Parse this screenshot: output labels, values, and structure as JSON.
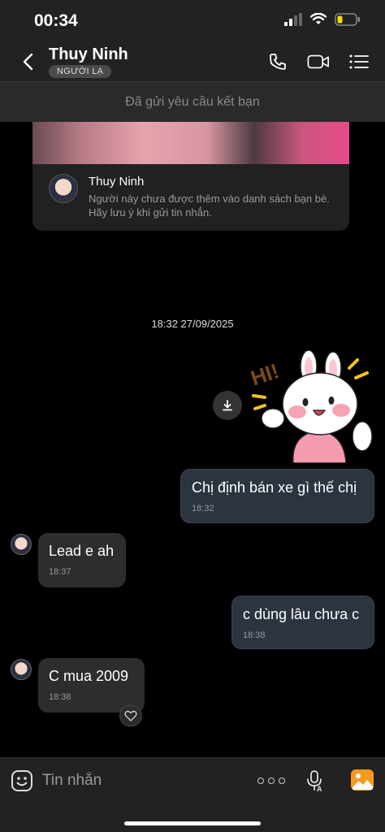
{
  "status_bar": {
    "time": "00:34"
  },
  "header": {
    "contact_name": "Thuy Ninh",
    "badge": "NGƯỜI LẠ"
  },
  "banner": {
    "text": "Đã gửi yêu cầu kết bạn"
  },
  "profile_card": {
    "name": "Thuy Ninh",
    "note": "Người này chưa được thêm vào danh sách bạn bè. Hãy lưu ý khi gửi tin nhắn."
  },
  "timestamp": "18:32 27/09/2025",
  "sticker": {
    "text": "HI!"
  },
  "messages": [
    {
      "from": "me",
      "text": "Chị định bán xe gì thế chị",
      "time": "18:32"
    },
    {
      "from": "them",
      "text": "Lead e ah",
      "time": "18:37"
    },
    {
      "from": "me",
      "text": "c dùng lâu chưa c",
      "time": "18:38"
    },
    {
      "from": "them",
      "text": "C mua 2009",
      "time": "18:38"
    }
  ],
  "composer": {
    "placeholder": "Tin nhắn"
  },
  "colors": {
    "background": "#000000",
    "bar": "#222222",
    "bubble_me": "#2c3440",
    "bubble_them": "#2d2d2d",
    "battery": "#f5d90a",
    "photo_icon": "#f59a1e"
  },
  "icons": {
    "back": "chevron-left-icon",
    "call": "phone-icon",
    "video": "video-camera-icon",
    "menu": "list-menu-icon",
    "download": "download-icon",
    "heart": "heart-icon",
    "emoji": "sticker-icon",
    "more": "more-dots-icon",
    "mic": "microphone-icon",
    "photo": "image-icon"
  }
}
